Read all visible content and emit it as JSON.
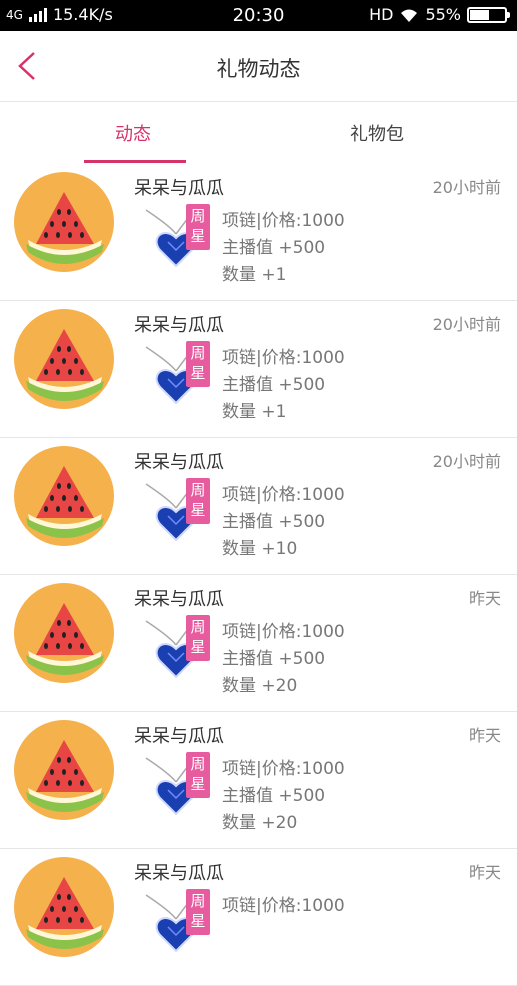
{
  "status": {
    "network": "4G",
    "speed": "15.4K/s",
    "time": "20:30",
    "hd": "HD",
    "battery": "55%",
    "battery_level": 0.55
  },
  "header": {
    "title": "礼物动态",
    "back_icon": "chevron-left-icon"
  },
  "tabs": [
    {
      "label": "动态",
      "active": true
    },
    {
      "label": "礼物包",
      "active": false
    }
  ],
  "items": [
    {
      "name": "呆呆与瓜瓜",
      "time": "20小时前",
      "badge_top": "周",
      "badge_bottom": "星",
      "gift": "项链|价格:1000",
      "anchor": "主播值 +500",
      "qty": "数量 +1"
    },
    {
      "name": "呆呆与瓜瓜",
      "time": "20小时前",
      "badge_top": "周",
      "badge_bottom": "星",
      "gift": "项链|价格:1000",
      "anchor": "主播值 +500",
      "qty": "数量 +1"
    },
    {
      "name": "呆呆与瓜瓜",
      "time": "20小时前",
      "badge_top": "周",
      "badge_bottom": "星",
      "gift": "项链|价格:1000",
      "anchor": "主播值 +500",
      "qty": "数量 +10"
    },
    {
      "name": "呆呆与瓜瓜",
      "time": "昨天",
      "badge_top": "周",
      "badge_bottom": "星",
      "gift": "项链|价格:1000",
      "anchor": "主播值 +500",
      "qty": "数量 +20"
    },
    {
      "name": "呆呆与瓜瓜",
      "time": "昨天",
      "badge_top": "周",
      "badge_bottom": "星",
      "gift": "项链|价格:1000",
      "anchor": "主播值 +500",
      "qty": "数量 +20"
    },
    {
      "name": "呆呆与瓜瓜",
      "time": "昨天",
      "badge_top": "周",
      "badge_bottom": "星",
      "gift": "项链|价格:1000",
      "anchor": "",
      "qty": ""
    }
  ]
}
